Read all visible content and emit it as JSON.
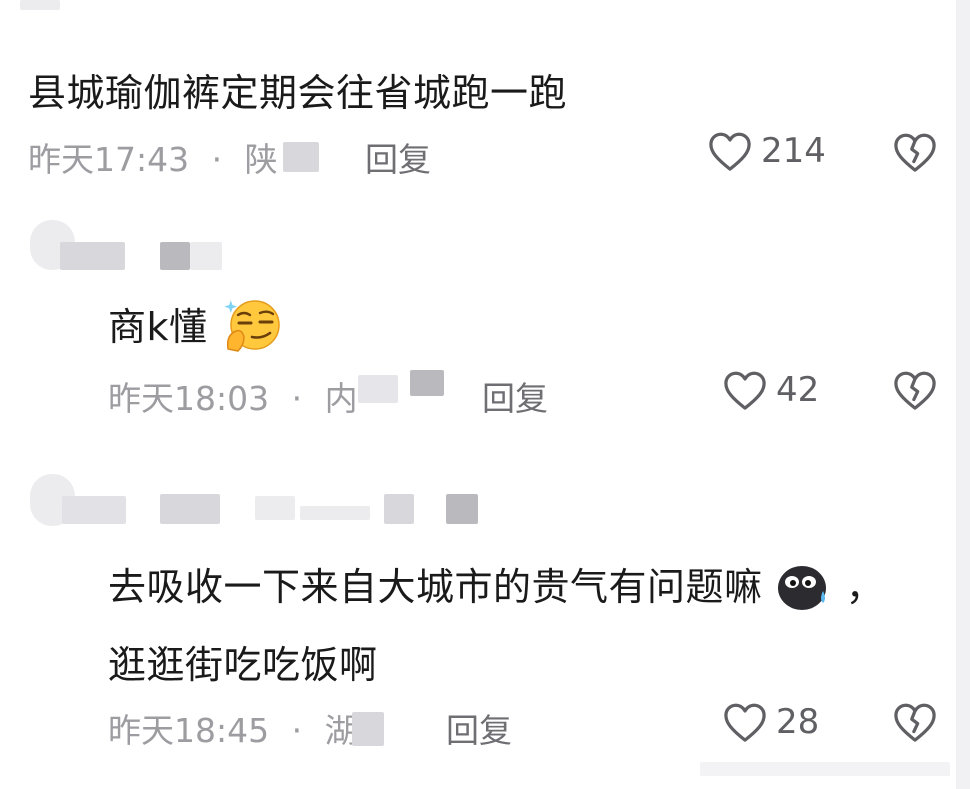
{
  "comments": [
    {
      "text": "县城瑜伽裤定期会往省城跑一跑",
      "time": "昨天17:43",
      "separator": "·",
      "location": "陕",
      "reply_label": "回复",
      "likes": "214"
    },
    {
      "text": "商k懂",
      "emoji": "smirking-face-hand-on-chin",
      "time": "昨天18:03",
      "separator": "·",
      "location": "内",
      "reply_label": "回复",
      "likes": "42"
    },
    {
      "text_line1": "去吸收一下来自大城市的贵气有问题嘛",
      "emoji": "sweating-black-blob-face",
      "text_line1_end": "，",
      "text_line2": "逛逛街吃吃饭啊",
      "time": "昨天18:45",
      "separator": "·",
      "location": "湖",
      "reply_label": "回复",
      "likes": "28"
    }
  ],
  "icons": {
    "like": "heart-outline-icon",
    "dislike": "broken-heart-outline-icon"
  },
  "colors": {
    "text": "#1a1a1a",
    "meta": "#9c9ca1",
    "reply": "#6e6e73",
    "icon": "#5f5f64"
  }
}
